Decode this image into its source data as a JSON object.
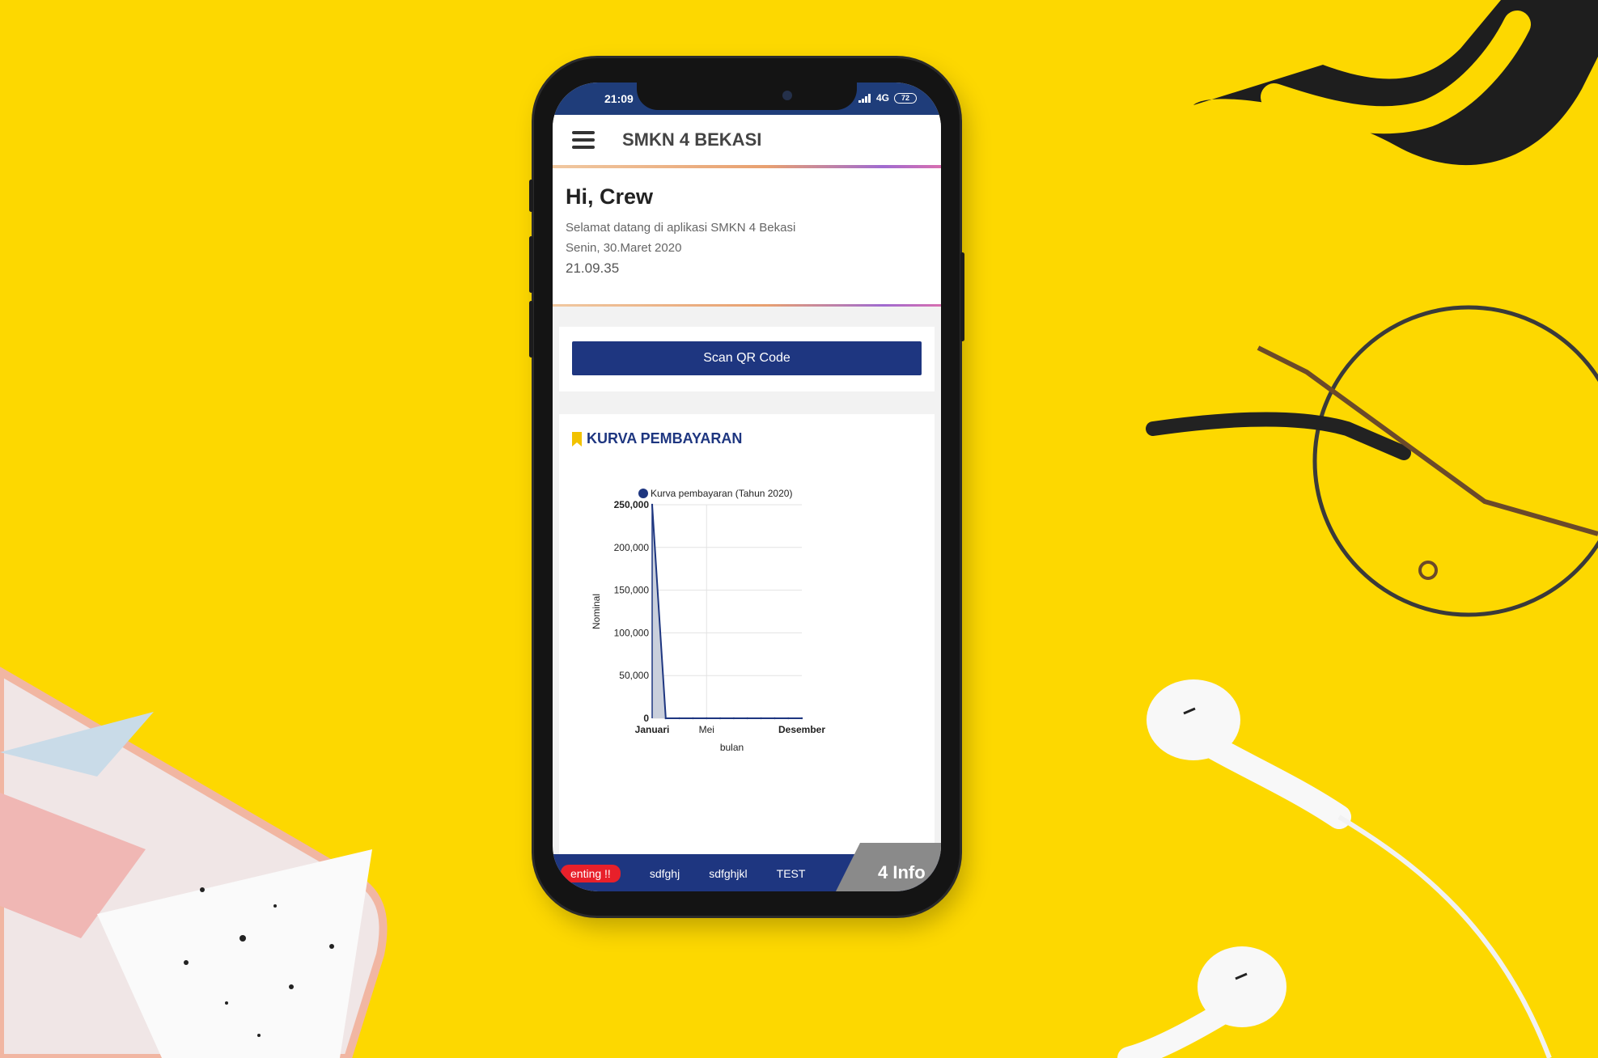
{
  "status_bar": {
    "time": "21:09",
    "network": "4G",
    "battery": "72"
  },
  "app_bar": {
    "title": "SMKN 4 BEKASI",
    "menu_icon": "hamburger-menu-icon"
  },
  "greeting": {
    "title": "Hi, Crew",
    "welcome": "Selamat datang di aplikasi SMKN 4 Bekasi",
    "date": "Senin, 30.Maret 2020",
    "time": "21.09.35"
  },
  "scan": {
    "button_label": "Scan QR Code"
  },
  "payment_section": {
    "heading": "KURVA PEMBAYARAN",
    "icon": "bookmark-icon",
    "icon_color": "#f2c200"
  },
  "chart_data": {
    "type": "area",
    "title": "",
    "legend": "Kurva pembayaran (Tahun 2020)",
    "legend_placement": "top",
    "xlabel": "bulan",
    "ylabel": "Nominal",
    "x_tick_labels": [
      "Januari",
      "Mei",
      "Desember"
    ],
    "y_tick_labels": [
      "0",
      "50,000",
      "100,000",
      "150,000",
      "200,000",
      "250,000"
    ],
    "ylim": [
      0,
      250000
    ],
    "grid": true,
    "series": [
      {
        "name": "Kurva pembayaran (Tahun 2020)",
        "color": "#1e3680",
        "fill": "#c9cfdc",
        "x": [
          1,
          2,
          3,
          4,
          5,
          6,
          7,
          8,
          9,
          10,
          11,
          12
        ],
        "values": [
          250000,
          0,
          0,
          0,
          0,
          0,
          0,
          0,
          0,
          0,
          0,
          0
        ]
      }
    ]
  },
  "ticker": {
    "badge": "enting !!",
    "items": [
      "sdfghj",
      "sdfghjkl",
      "TEST"
    ],
    "info_tab": "4 Info"
  },
  "colors": {
    "background": "#fdd800",
    "primary": "#1e3680",
    "status_bar": "#1f3d7a",
    "alert": "#e8202a"
  }
}
